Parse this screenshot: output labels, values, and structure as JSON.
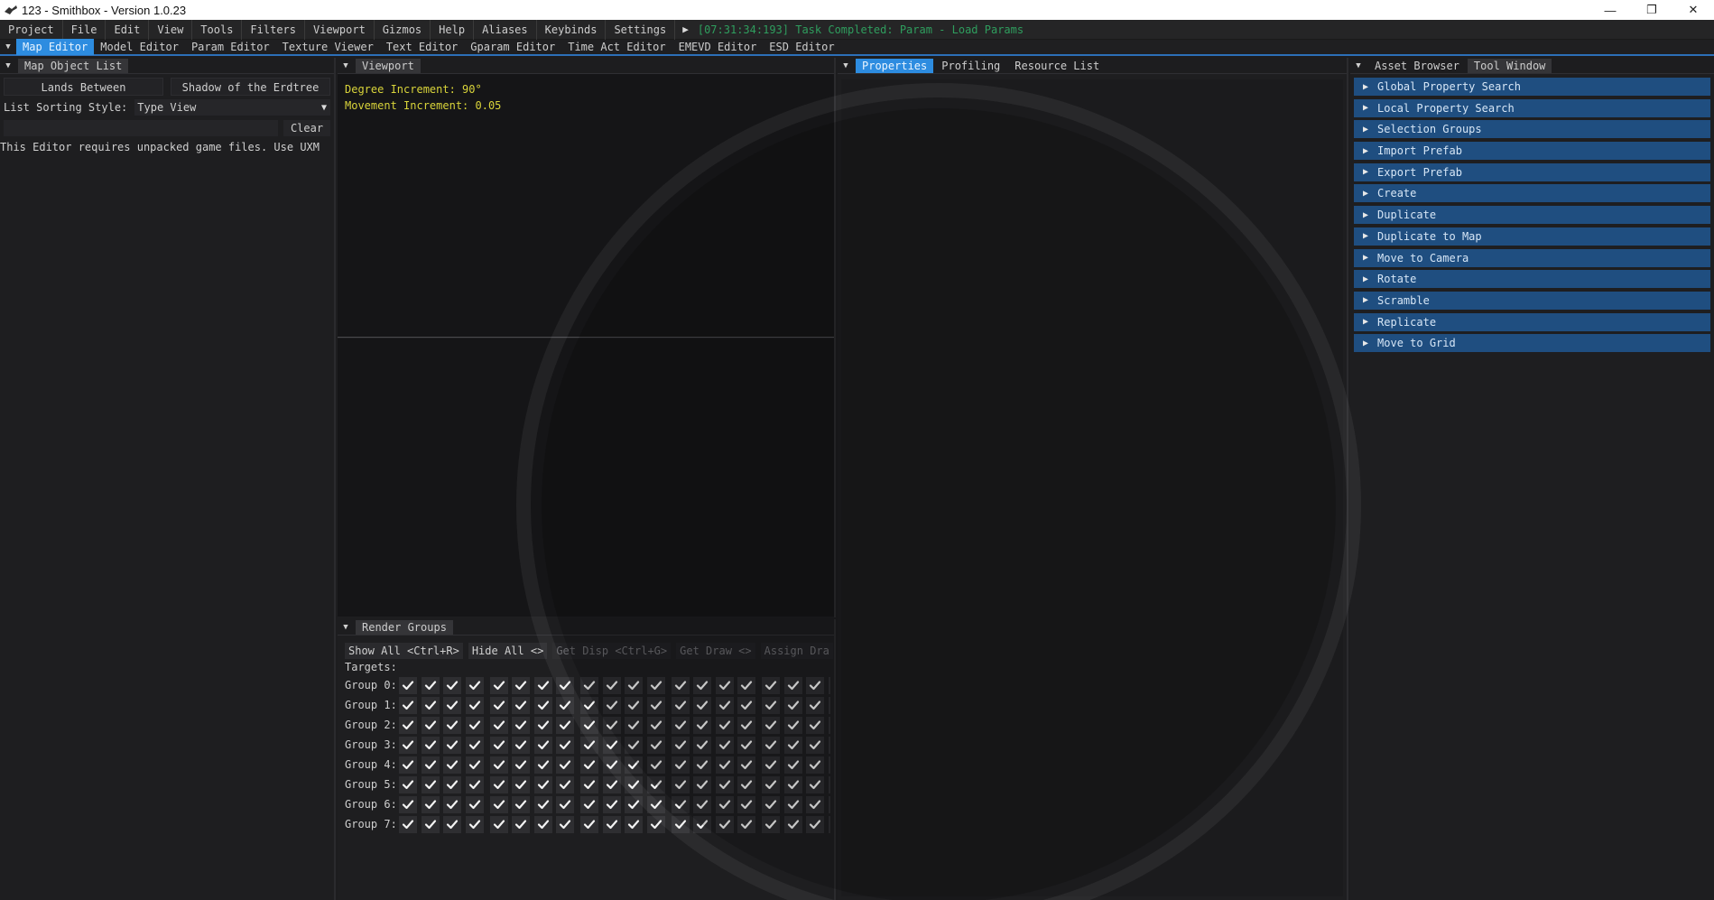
{
  "window": {
    "title": "123 - Smithbox - Version 1.0.23",
    "minimize_glyph": "—",
    "restore_glyph": "❐",
    "close_glyph": "✕"
  },
  "menubar": {
    "items": [
      "Project",
      "File",
      "Edit",
      "View",
      "Tools",
      "Filters",
      "Viewport",
      "Gizmos",
      "Help",
      "Aliases",
      "Keybinds",
      "Settings"
    ],
    "play_glyph": "▶",
    "status": "[07:31:34:193] Task Completed: Param - Load Params"
  },
  "editors": {
    "tabs": [
      "Map Editor",
      "Model Editor",
      "Param Editor",
      "Texture Viewer",
      "Text Editor",
      "Gparam Editor",
      "Time Act Editor",
      "EMEVD Editor",
      "ESD Editor"
    ]
  },
  "left_panel": {
    "tab": "Map Object List",
    "region_buttons": [
      "Lands Between",
      "Shadow of the Erdtree"
    ],
    "sort_label": "List Sorting Style:",
    "sort_value": "Type View",
    "filter_value": "",
    "clear_label": "Clear",
    "note": "This Editor requires unpacked game files. Use UXM"
  },
  "viewport": {
    "tab": "Viewport",
    "degree_increment": "Degree Increment: 90°",
    "movement_increment": "Movement Increment: 0.05"
  },
  "render_groups": {
    "tab": "Render Groups",
    "buttons": [
      {
        "label": "Show All <Ctrl+R>",
        "enabled": true
      },
      {
        "label": "Hide All <>",
        "enabled": true
      },
      {
        "label": "Get Disp <Ctrl+G>",
        "enabled": false
      },
      {
        "label": "Get Draw <>",
        "enabled": false
      },
      {
        "label": "Assign Dra",
        "enabled": false
      }
    ],
    "targets_label": "Targets:",
    "groups": [
      "Group 0:",
      "Group 1:",
      "Group 2:",
      "Group 3:",
      "Group 4:",
      "Group 5:",
      "Group 6:",
      "Group 7:"
    ],
    "checks_per_row": 20
  },
  "properties": {
    "tabs": [
      "Properties",
      "Profiling",
      "Resource List"
    ]
  },
  "asset_browser": {
    "tabs": [
      "Asset Browser",
      "Tool Window"
    ],
    "tools": [
      "Global Property Search",
      "Local Property Search",
      "Selection Groups",
      "Import Prefab",
      "Export Prefab",
      "Create",
      "Duplicate",
      "Duplicate to Map",
      "Move to Camera",
      "Rotate",
      "Scramble",
      "Replicate",
      "Move to Grid"
    ]
  },
  "colors": {
    "accent": "#2d8ce0",
    "tool_item": "#1f4e80",
    "status_green": "#2f9e5e",
    "viewport_text": "#d9d43a"
  }
}
